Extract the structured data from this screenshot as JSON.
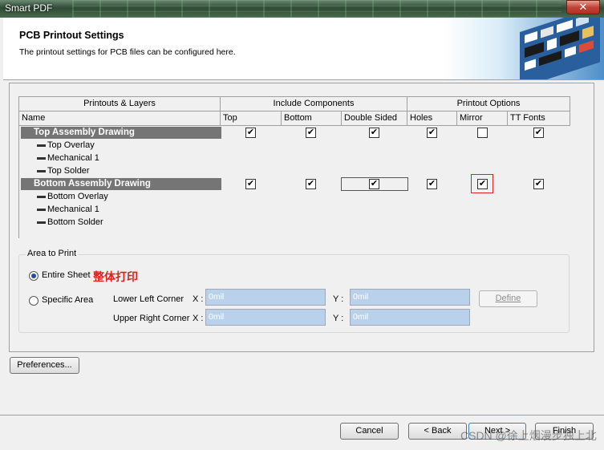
{
  "window": {
    "title": "Smart PDF",
    "close_label": "✕"
  },
  "header": {
    "title": "PCB Printout Settings",
    "subtitle": "The printout settings for PCB files can be configured here."
  },
  "table": {
    "group_headers": [
      "Printouts & Layers",
      "Include Components",
      "Printout Options"
    ],
    "columns": [
      "Name",
      "Top",
      "Bottom",
      "Double Sided",
      "Holes",
      "Mirror",
      "TT Fonts"
    ],
    "groups": [
      {
        "name": "Top Assembly Drawing",
        "checks": [
          "✔",
          "✔",
          "✔",
          "✔",
          "",
          "✔"
        ],
        "layers": [
          "Top Overlay",
          "Mechanical 1",
          "Top Solder"
        ]
      },
      {
        "name": "Bottom Assembly Drawing",
        "checks": [
          "✔",
          "✔",
          "✔",
          "✔",
          "✔",
          "✔"
        ],
        "layers": [
          "Bottom Overlay",
          "Mechanical 1",
          "Bottom Solder"
        ]
      }
    ]
  },
  "area_to_print": {
    "legend": "Area to Print",
    "entire_sheet": "Entire Sheet",
    "annotation": "整体打印",
    "specific_area": "Specific Area",
    "lower_left": "Lower Left Corner",
    "upper_right": "Upper Right Corner",
    "x_label": "X :",
    "y_label": "Y :",
    "ll_x": "0mil",
    "ll_y": "0mil",
    "ur_x": "0mil",
    "ur_y": "0mil",
    "define_label": "Define"
  },
  "buttons": {
    "preferences": "Preferences...",
    "cancel": "Cancel",
    "back": "< Back",
    "next": "Next >",
    "finish": "Finish"
  },
  "watermark": "CSDN @徐上烟漫步独上北"
}
